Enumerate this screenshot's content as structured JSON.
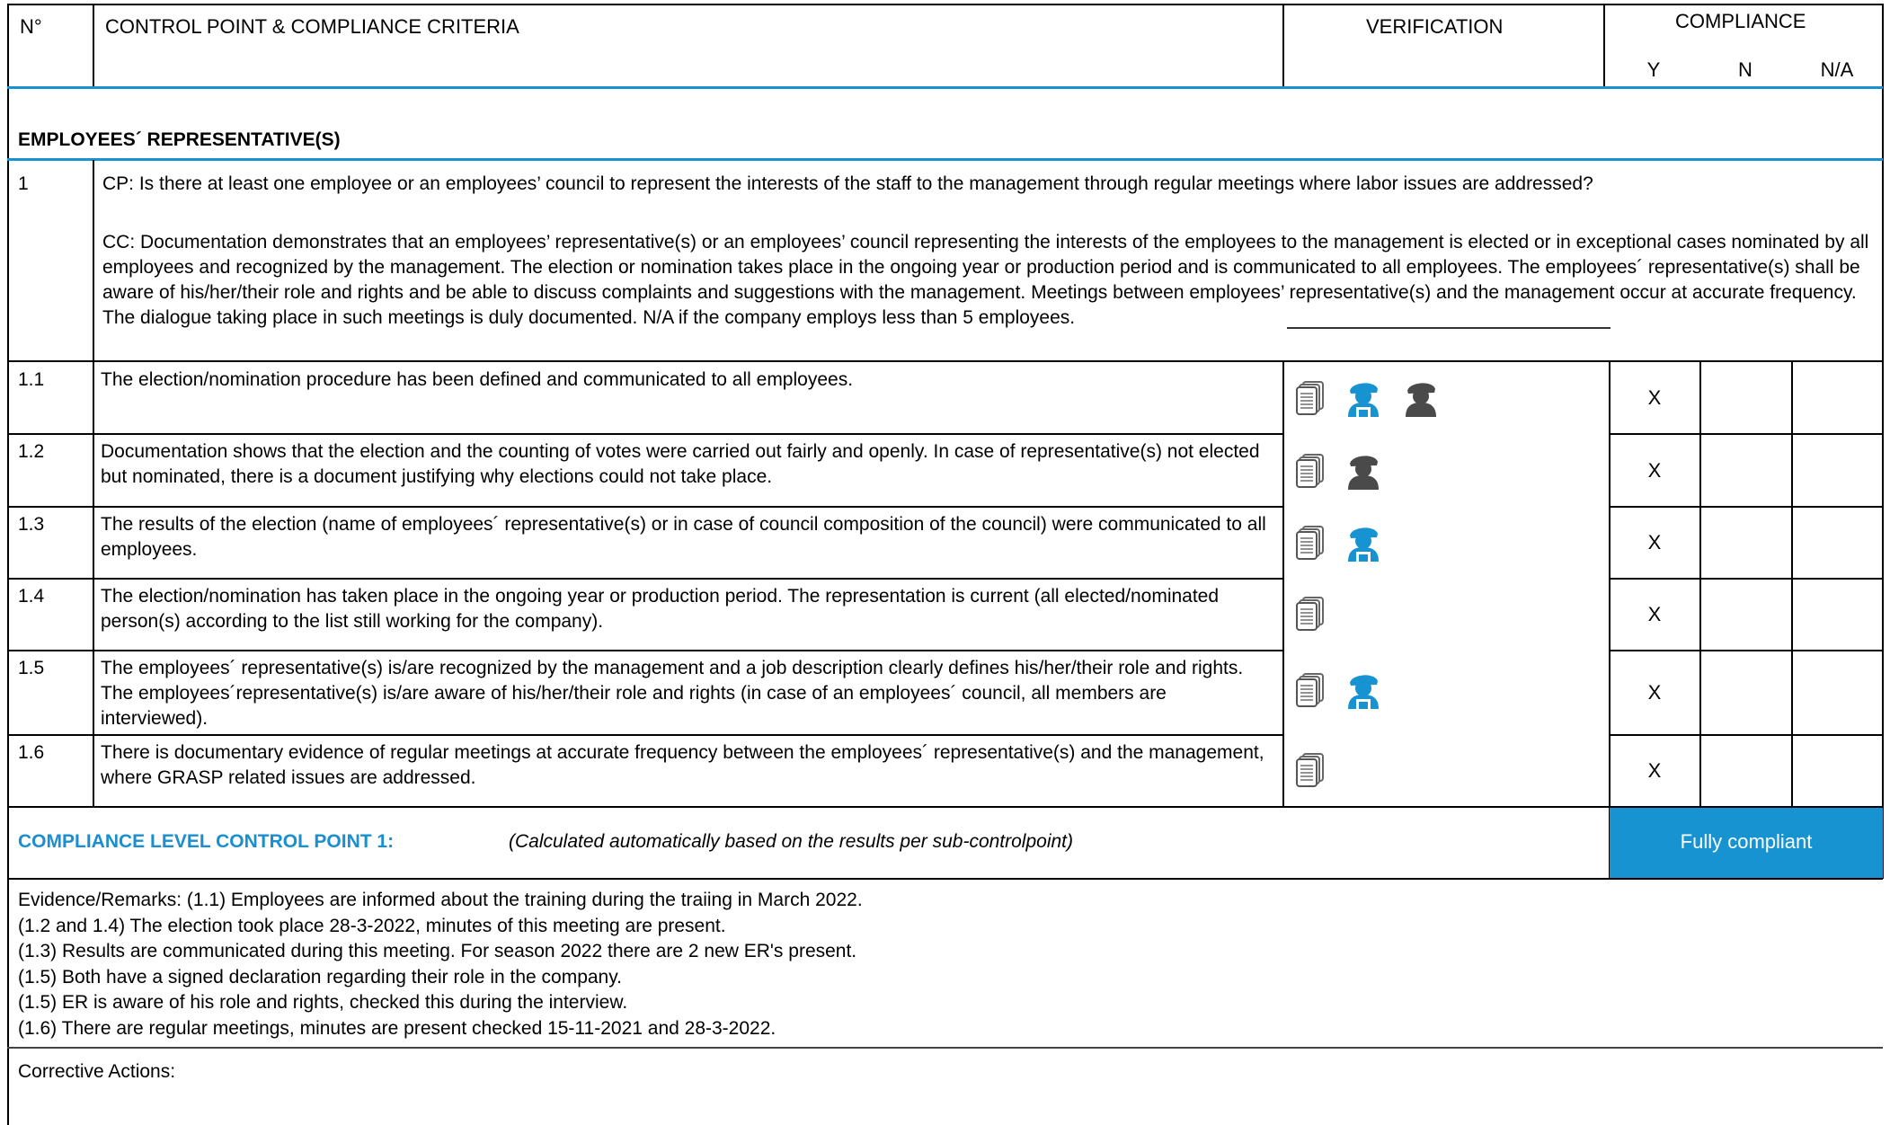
{
  "header": {
    "no": "N°",
    "criteria": "CONTROL POINT & COMPLIANCE CRITERIA",
    "verification": "VERIFICATION",
    "compliance": "COMPLIANCE",
    "y": "Y",
    "n": "N",
    "na": "N/A"
  },
  "section": {
    "title": "EMPLOYEES´ REPRESENTATIVE(S)"
  },
  "cp": {
    "number": "1",
    "question": "CP: Is there at least one employee or an employees’ council to represent the interests of the staff to the management through regular meetings where labor issues are addressed?",
    "criteria": "CC: Documentation demonstrates that an employees’ representative(s) or an employees’ council representing the interests of the employees to the management is elected or in exceptional cases nominated by all employees and recognized by the management. The election or nomination takes place in the ongoing year or production period and is communicated to all employees. The employees´ representative(s) shall be aware of his/her/their role and rights and be able to discuss complaints and suggestions with the management. Meetings between employees’ representative(s) and the management occur at accurate frequency. The dialogue taking place in such meetings is duly documented. N/A if the company employs less than 5 employees."
  },
  "rows": [
    {
      "number": "1.1",
      "text": "The election/nomination procedure has been defined and communicated to all employees.",
      "y": "X",
      "n": "",
      "na": "",
      "icons": [
        "document-icon",
        "worker-blue-icon",
        "worker-gray-icon"
      ]
    },
    {
      "number": "1.2",
      "text": "Documentation shows that the election and the counting of votes were carried out fairly and openly. In case of representative(s) not elected but nominated, there is a document justifying why elections could not take place.",
      "y": "X",
      "n": "",
      "na": "",
      "icons": [
        "document-icon",
        "worker-gray-icon"
      ]
    },
    {
      "number": "1.3",
      "text": "The results of the election (name of employees´ representative(s) or in case of council composition of the council) were communicated to all employees.",
      "y": "X",
      "n": "",
      "na": "",
      "icons": [
        "document-icon",
        "worker-blue-icon"
      ]
    },
    {
      "number": "1.4",
      "text": "The election/nomination has taken place in the ongoing year or production period. The representation is current (all elected/nominated person(s) according to the list still working for the company).",
      "y": "X",
      "n": "",
      "na": "",
      "icons": [
        "document-icon"
      ]
    },
    {
      "number": "1.5",
      "text": "The employees´ representative(s) is/are recognized by the management and a job description clearly defines his/her/their role and rights. The employees´representative(s) is/are aware of his/her/their role and rights (in case of an employees´ council, all members are interviewed).",
      "y": "X",
      "n": "",
      "na": "",
      "icons": [
        "document-icon",
        "worker-blue-icon"
      ]
    },
    {
      "number": "1.6",
      "text": "There is documentary evidence of regular meetings at accurate frequency between the employees´ representative(s) and the management, where GRASP related issues are addressed.",
      "y": "X",
      "n": "",
      "na": "",
      "icons": [
        "document-icon"
      ]
    }
  ],
  "compliance_level": {
    "label": "COMPLIANCE LEVEL CONTROL POINT 1:",
    "note": "(Calculated automatically based on the results per sub-controlpoint)",
    "result": "Fully compliant"
  },
  "evidence": {
    "lines": [
      "Evidence/Remarks: (1.1) Employees are informed about the training during the traiing in March 2022.",
      "(1.2 and 1.4) The election took place 28-3-2022, minutes of this meeting are present.",
      "(1.3) Results are communicated during this meeting. For season 2022 there are 2 new ER's present.",
      "(1.5) Both have a signed declaration regarding their role in the company.",
      "(1.5) ER is aware of his role and rights, checked this during the interview.",
      "(1.6) There are regular meetings, minutes are present checked 15-11-2021 and 28-3-2022."
    ]
  },
  "corrective": {
    "label": "Corrective Actions:"
  },
  "colors": {
    "accent": "#1793d1",
    "accent_text": "#1a8fcf",
    "icon_gray": "#4a4a4a"
  }
}
